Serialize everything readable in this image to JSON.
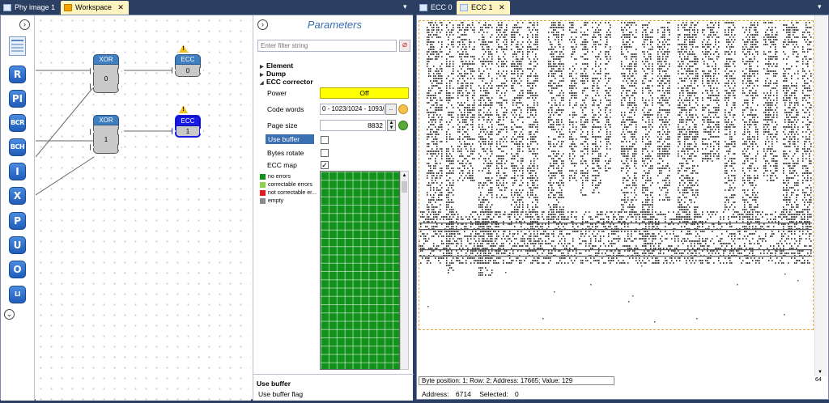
{
  "left_tabs": [
    {
      "label": "Phy image 1",
      "active": false
    },
    {
      "label": "Workspace",
      "active": true,
      "close": "✕"
    }
  ],
  "right_tabs": [
    {
      "label": "ECC 0",
      "active": false
    },
    {
      "label": "ECC 1",
      "active": true,
      "close": "✕"
    }
  ],
  "toolbox": [
    "R",
    "PI",
    "BCR",
    "BCH",
    "I",
    "X",
    "P",
    "U",
    "O",
    "LI"
  ],
  "blocks": {
    "xor0": {
      "title": "XOR",
      "value": "0"
    },
    "ecc0": {
      "title": "ECC",
      "value": "0"
    },
    "xor1": {
      "title": "XOR",
      "value": "1"
    },
    "ecc1": {
      "title": "ECC",
      "value": "1"
    }
  },
  "params": {
    "title": "Parameters",
    "filter_placeholder": "Enter filter string",
    "groups": [
      "Element",
      "Dump",
      "ECC corrector"
    ],
    "power_label": "Power",
    "power_value": "Off",
    "code_words_label": "Code words",
    "code_words_value": "0 - 1023/1024 - 1093/",
    "code_words_btn": "..",
    "page_size_label": "Page size",
    "page_size_value": "8832",
    "use_buffer_label": "Use buffer",
    "bytes_rotate_label": "Bytes rotate",
    "ecc_map_label": "ECC map",
    "ecc_map_checked": "✓",
    "legend": [
      {
        "label": "no errors",
        "color": "#11921b"
      },
      {
        "label": "correctable errors",
        "color": "#8fd14f"
      },
      {
        "label": "not correctable er...",
        "color": "#e81b1b"
      },
      {
        "label": "empty",
        "color": "#8a8a8a"
      }
    ],
    "help_title": "Use buffer",
    "help_text": "Use buffer flag"
  },
  "status": {
    "text": "Byte position: 1; Row: 2; Address: 17665; Value: 129",
    "address_label": "Address:",
    "address_value": "6714",
    "selected_label": "Selected:",
    "selected_value": "0",
    "zoom": "64"
  },
  "colors": {
    "power_bg": "#ffff00",
    "highlight": "#3a6fb0",
    "active_block": "#1a1ae6"
  }
}
